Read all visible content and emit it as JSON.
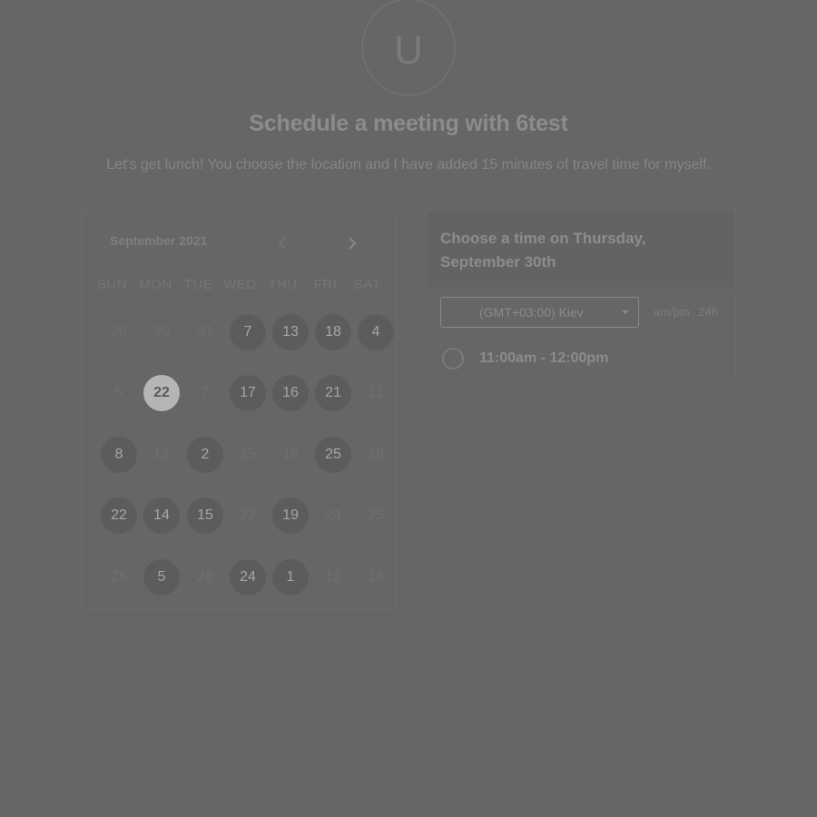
{
  "host": {
    "avatar_letter": "U"
  },
  "header": {
    "title": "Schedule a meeting with 6test",
    "description": "Let's get lunch! You choose the location and I have added 15 minutes of travel time for myself."
  },
  "calendar": {
    "month_label": "September 2021",
    "prev_icon": "chevron-left-icon",
    "next_icon": "chevron-right-icon",
    "weekdays": [
      "SUN",
      "MON",
      "TUE",
      "WED",
      "THU",
      "FRI",
      "SAT"
    ],
    "weeks": [
      [
        {
          "label": "29",
          "state": "disabled"
        },
        {
          "label": "30",
          "state": "disabled"
        },
        {
          "label": "31",
          "state": "disabled"
        },
        {
          "label": "7",
          "state": "available"
        },
        {
          "label": "13",
          "state": "available"
        },
        {
          "label": "18",
          "state": "available"
        },
        {
          "label": "4",
          "state": "available"
        }
      ],
      [
        {
          "label": "5",
          "state": "disabled"
        },
        {
          "label": "22",
          "state": "selected"
        },
        {
          "label": "7",
          "state": "disabled"
        },
        {
          "label": "17",
          "state": "available"
        },
        {
          "label": "16",
          "state": "available"
        },
        {
          "label": "21",
          "state": "available"
        },
        {
          "label": "11",
          "state": "disabled"
        }
      ],
      [
        {
          "label": "8",
          "state": "available"
        },
        {
          "label": "13",
          "state": "disabled"
        },
        {
          "label": "2",
          "state": "available"
        },
        {
          "label": "15",
          "state": "disabled"
        },
        {
          "label": "16",
          "state": "disabled"
        },
        {
          "label": "25",
          "state": "available"
        },
        {
          "label": "18",
          "state": "disabled"
        }
      ],
      [
        {
          "label": "22",
          "state": "available"
        },
        {
          "label": "14",
          "state": "available"
        },
        {
          "label": "15",
          "state": "available"
        },
        {
          "label": "22",
          "state": "disabled"
        },
        {
          "label": "19",
          "state": "available"
        },
        {
          "label": "24",
          "state": "disabled"
        },
        {
          "label": "25",
          "state": "disabled"
        }
      ],
      [
        {
          "label": "26",
          "state": "disabled"
        },
        {
          "label": "5",
          "state": "available"
        },
        {
          "label": "28",
          "state": "disabled"
        },
        {
          "label": "24",
          "state": "available"
        },
        {
          "label": "1",
          "state": "available"
        },
        {
          "label": "12",
          "state": "disabled"
        },
        {
          "label": "14",
          "state": "disabled"
        }
      ]
    ]
  },
  "time_panel": {
    "heading": "Choose a time on Thursday, September 30th",
    "timezone": "(GMT+03:00) Kiev",
    "format_ampm": "am/pm",
    "format_24h": "24h",
    "slots": [
      {
        "label": "11:00am - 12:00pm"
      }
    ]
  }
}
